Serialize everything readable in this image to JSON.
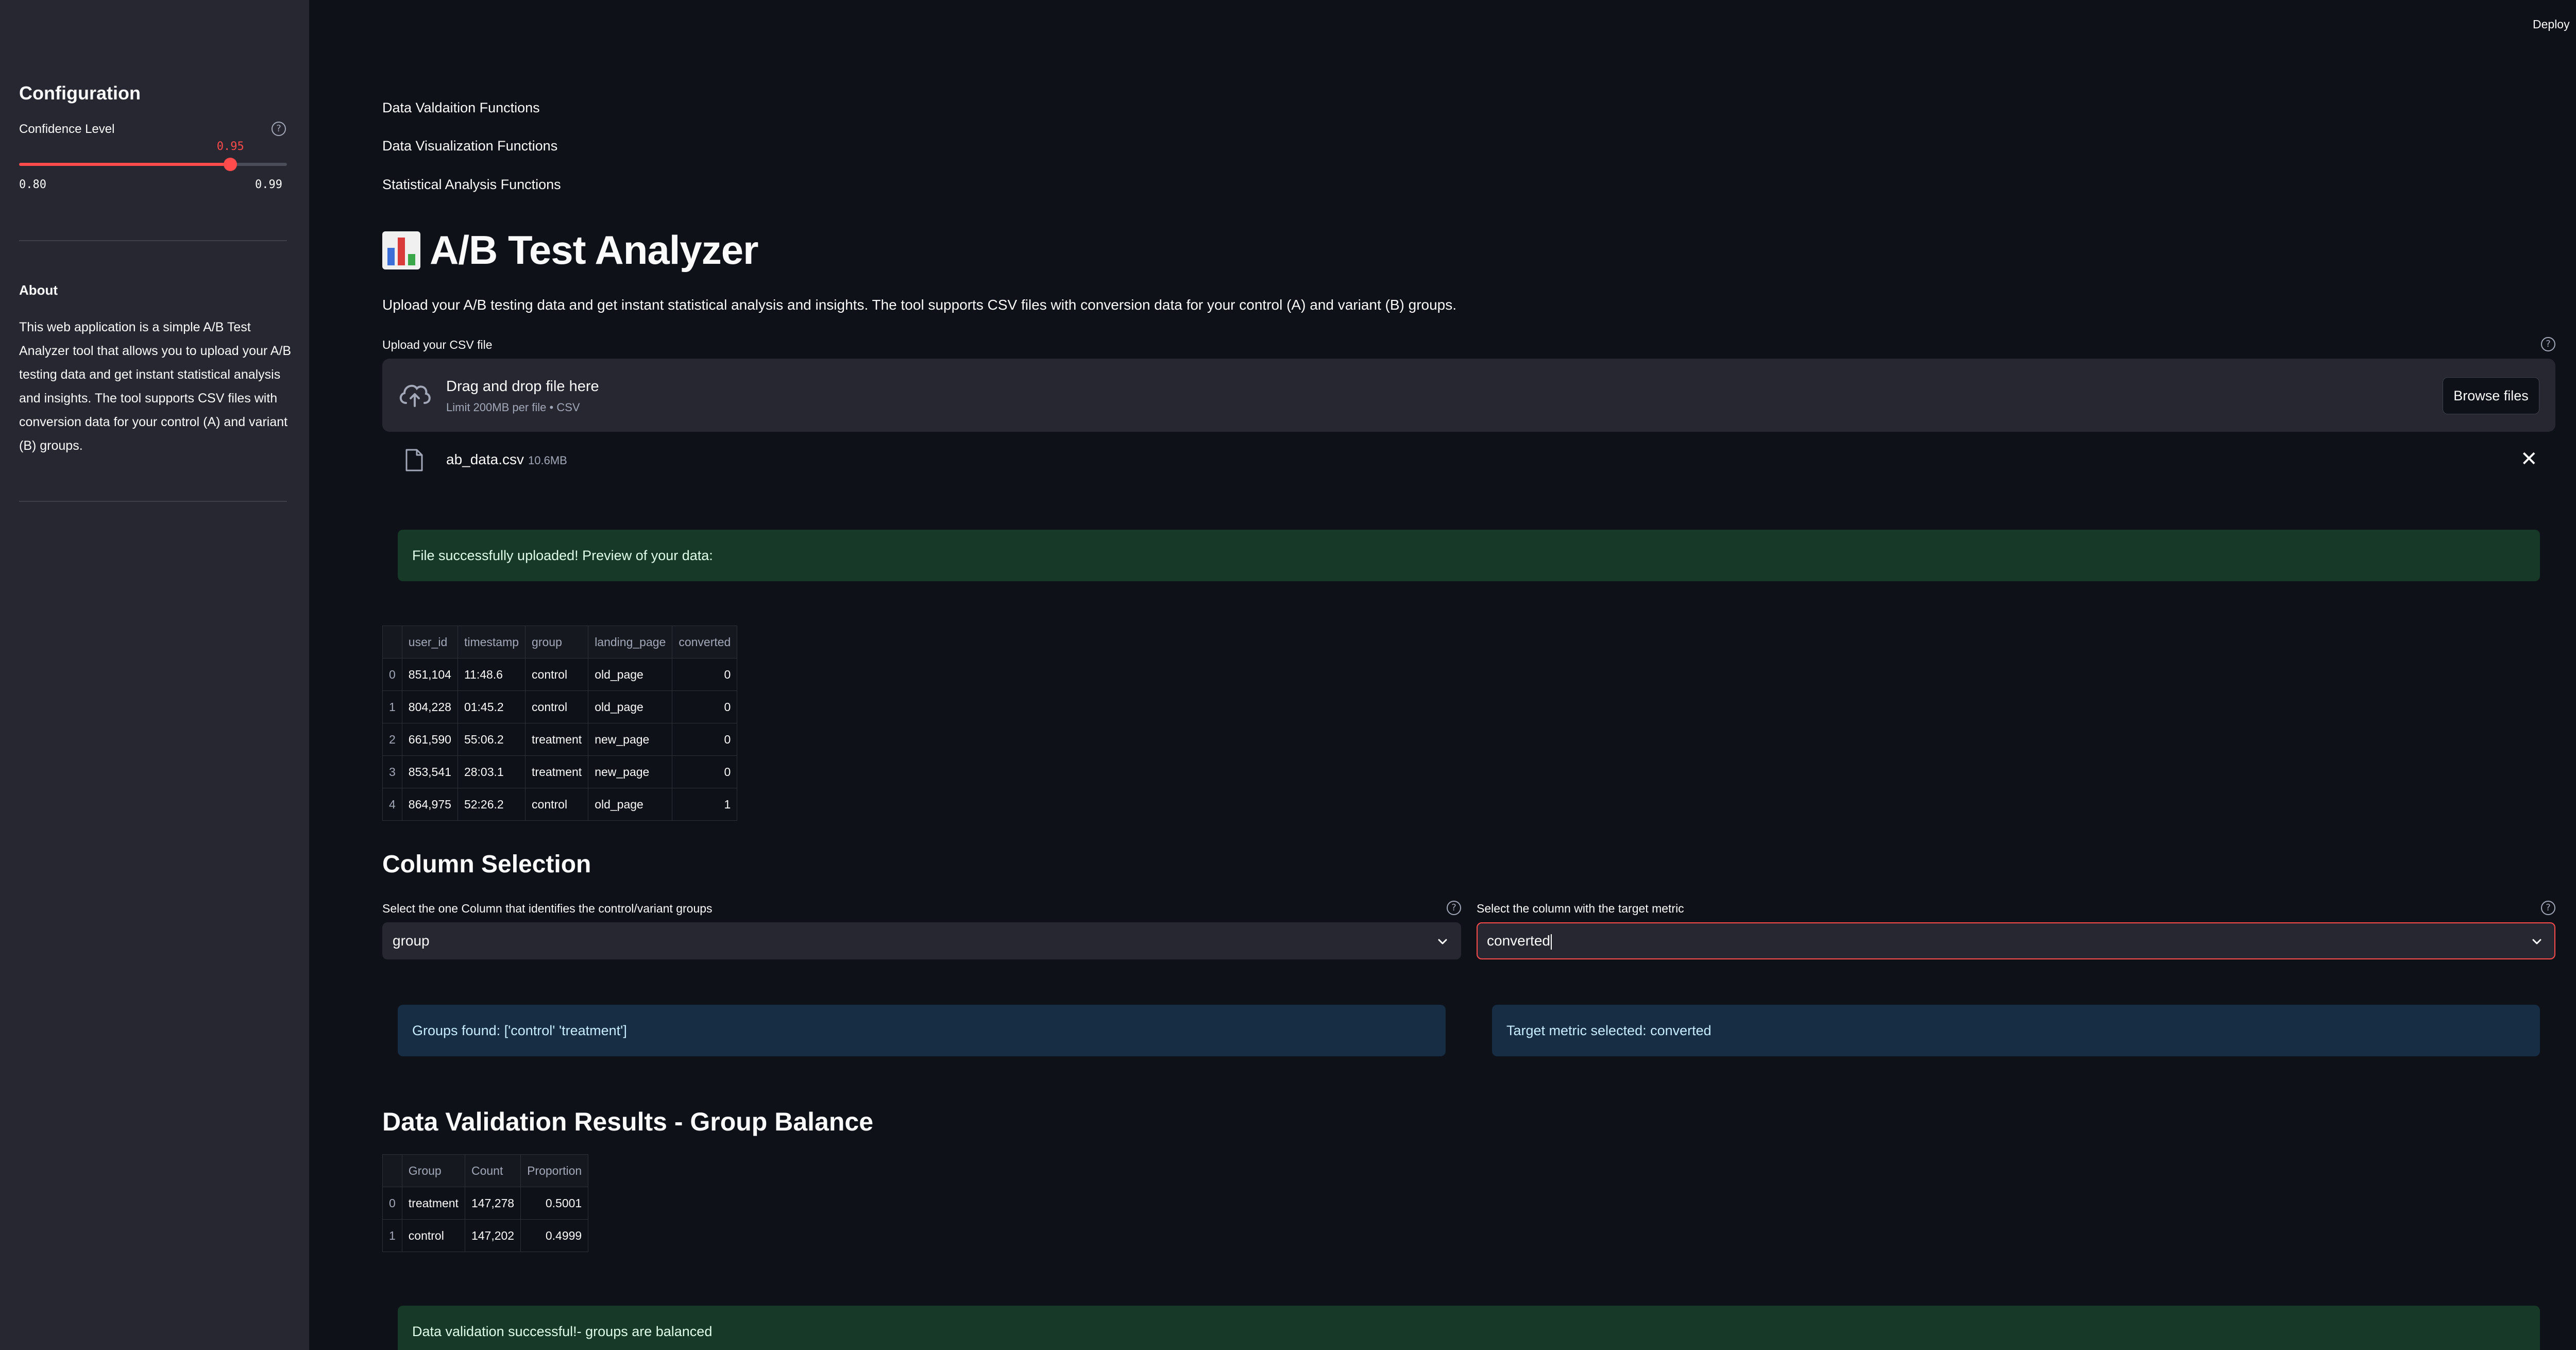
{
  "header": {
    "deploy_label": "Deploy",
    "menu_icon": "kebab-menu-icon"
  },
  "sidebar": {
    "title": "Configuration",
    "slider": {
      "label": "Confidence Level",
      "value": "0.95",
      "min": "0.80",
      "max": "0.99",
      "fraction": 0.789,
      "accent": "#ff4b4b"
    },
    "about_title": "About",
    "about_text": "This web application is a simple A/B Test Analyzer tool that allows you to upload your A/B testing data and get instant statistical analysis and insights. The tool supports CSV files with conversion data for your control (A) and variant (B) groups."
  },
  "nav_links": [
    "Data Valdaition Functions",
    "Data Visualization Functions",
    "Statistical Analysis Functions"
  ],
  "title": "A/B Test Analyzer",
  "intro": "Upload your A/B testing data and get instant statistical analysis and insights. The tool supports CSV files with conversion data for your control (A) and variant (B) groups.",
  "uploader": {
    "label": "Upload your CSV file",
    "drop_title": "Drag and drop file here",
    "drop_sub": "Limit 200MB per file • CSV",
    "browse_label": "Browse files",
    "file_name": "ab_data.csv",
    "file_size": "10.6MB"
  },
  "upload_success": "File successfully uploaded! Preview of your data:",
  "preview_table": {
    "columns": [
      "",
      "user_id",
      "timestamp",
      "group",
      "landing_page",
      "converted"
    ],
    "rows": [
      [
        "0",
        "851,104",
        "11:48.6",
        "control",
        "old_page",
        "0"
      ],
      [
        "1",
        "804,228",
        "01:45.2",
        "control",
        "old_page",
        "0"
      ],
      [
        "2",
        "661,590",
        "55:06.2",
        "treatment",
        "new_page",
        "0"
      ],
      [
        "3",
        "853,541",
        "28:03.1",
        "treatment",
        "new_page",
        "0"
      ],
      [
        "4",
        "864,975",
        "52:26.2",
        "control",
        "old_page",
        "1"
      ]
    ]
  },
  "column_selection": {
    "heading": "Column Selection",
    "group_label": "Select the one Column that identifies the control/variant groups",
    "group_value": "group",
    "metric_label": "Select the column with the target metric",
    "metric_value": "converted",
    "groups_found": "Groups found: ['control' 'treatment']",
    "metric_selected": "Target metric selected: converted"
  },
  "validation": {
    "heading": "Data Validation Results - Group Balance",
    "columns": [
      "",
      "Group",
      "Count",
      "Proportion"
    ],
    "rows": [
      [
        "0",
        "treatment",
        "147,278",
        "0.5001"
      ],
      [
        "1",
        "control",
        "147,202",
        "0.4999"
      ]
    ],
    "success": "Data validation successful!- groups are balanced"
  },
  "colors": {
    "background": "#0e1117",
    "sidebar": "#262730",
    "success_bg": "#173928",
    "info_bg": "#172d43",
    "accent": "#ff4b4b"
  }
}
